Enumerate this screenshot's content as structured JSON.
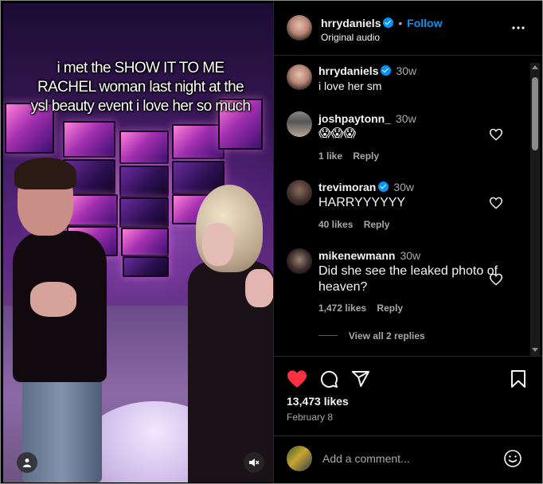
{
  "video": {
    "caption": "i met the SHOW IT TO ME RACHEL woman last night at the ysl beauty event i love her so much"
  },
  "header": {
    "username": "hrrydaniels",
    "dot": "•",
    "follow_label": "Follow",
    "subtitle": "Original audio",
    "more_icon": "more-horizontal-icon"
  },
  "comments": [
    {
      "username": "hrrydaniels",
      "verified": true,
      "time": "30w",
      "text": "i love her sm"
    },
    {
      "username": "joshpaytonn_",
      "verified": false,
      "time": "30w",
      "text": "😱😱😱",
      "likes": "1 like",
      "reply": "Reply"
    },
    {
      "username": "trevimoran",
      "verified": true,
      "time": "30w",
      "text": "HARRYYYYYY",
      "likes": "40 likes",
      "reply": "Reply"
    },
    {
      "username": "mikenewmann",
      "verified": false,
      "time": "30w",
      "text": "Did she see the leaked photo of heaven?",
      "likes": "1,472 likes",
      "reply": "Reply",
      "view_replies": "View all 2 replies"
    }
  ],
  "actions": {
    "likes": "13,473 likes",
    "date": "February 8",
    "liked_color": "#ff3040"
  },
  "add_comment": {
    "placeholder": "Add a comment..."
  },
  "colors": {
    "accent": "#0095f6",
    "background": "#000000"
  }
}
